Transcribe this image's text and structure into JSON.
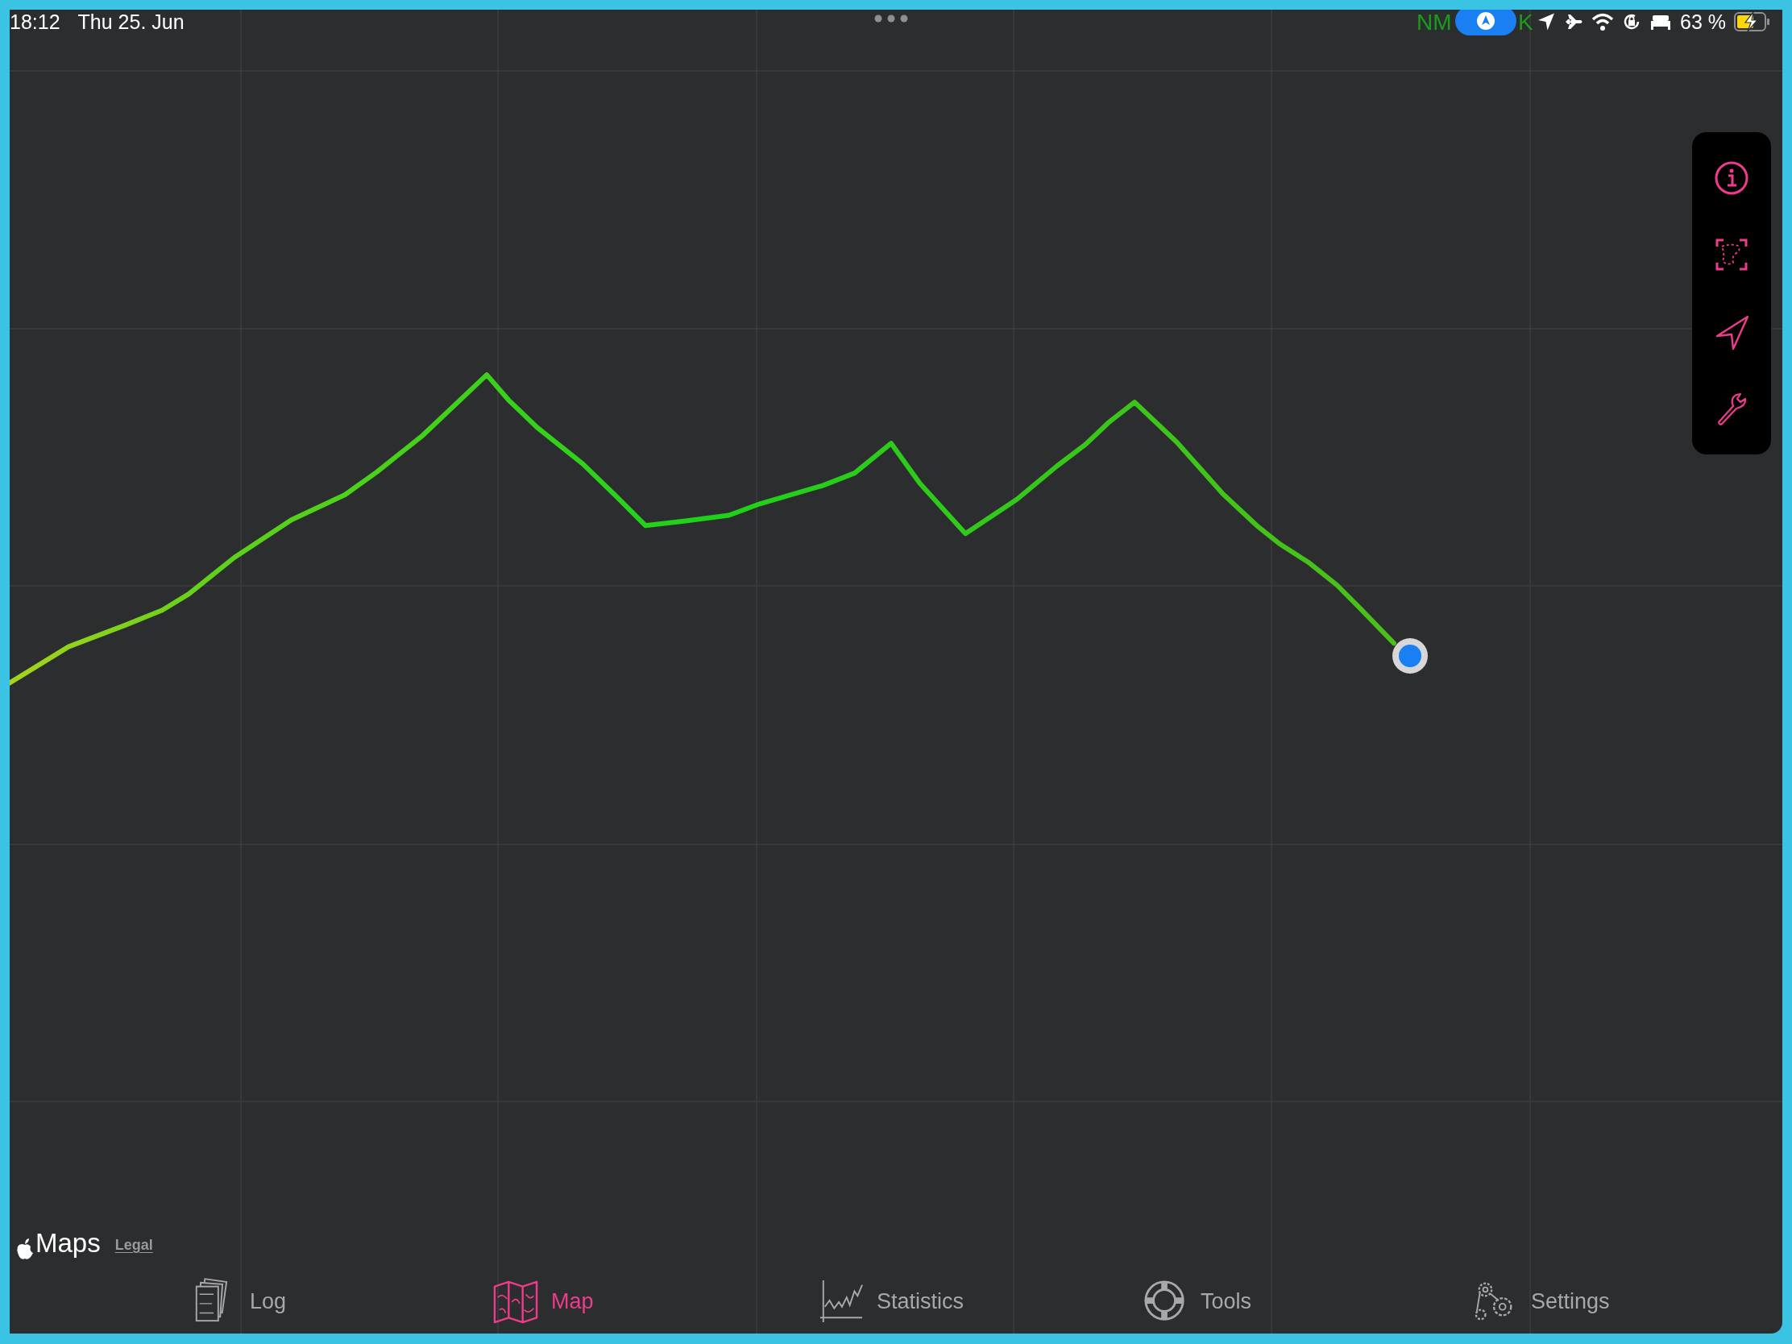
{
  "status_bar": {
    "time": "18:12",
    "date": "Thu 25. Jun",
    "nmea_fragments": [
      "NM",
      "K"
    ],
    "battery_text": "63 %",
    "charging": true
  },
  "map_controls": [
    {
      "kind": "info"
    },
    {
      "kind": "region"
    },
    {
      "kind": "locate"
    },
    {
      "kind": "tools"
    }
  ],
  "map_attribution": {
    "brand": "Maps",
    "legal": "Legal"
  },
  "tabs": [
    {
      "label": "Log",
      "kind": "log",
      "selected": false
    },
    {
      "label": "Map",
      "kind": "map",
      "selected": true
    },
    {
      "label": "Statistics",
      "kind": "statistics",
      "selected": false
    },
    {
      "label": "Tools",
      "kind": "tools",
      "selected": false
    },
    {
      "label": "Settings",
      "kind": "settings",
      "selected": false
    }
  ]
}
